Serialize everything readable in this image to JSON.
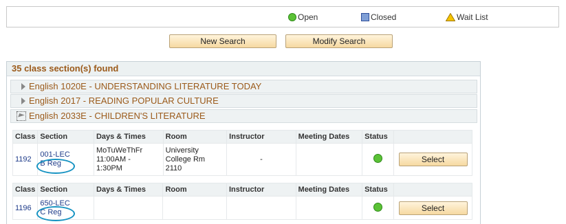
{
  "legend": {
    "open_label": "Open",
    "closed_label": "Closed",
    "wait_label": "Wait List"
  },
  "buttons": {
    "new_search": "New Search",
    "modify_search": "Modify Search"
  },
  "results": {
    "header": "35 class section(s) found",
    "courses": [
      {
        "title": "English 1020E - UNDERSTANDING LITERATURE TODAY",
        "expanded": false
      },
      {
        "title": "English 2017 - READING POPULAR CULTURE",
        "expanded": false
      },
      {
        "title": "English 2033E - CHILDREN'S LITERATURE",
        "expanded": true
      }
    ],
    "columns": [
      "Class",
      "Section",
      "Days & Times",
      "Room",
      "Instructor",
      "Meeting Dates",
      "Status",
      ""
    ],
    "sections": [
      {
        "class": "1192",
        "section_line1": "001-LEC",
        "section_line2": "B Reg",
        "days_times_1": "MoTuWeThFr",
        "days_times_2": "11:00AM -",
        "days_times_3": "1:30PM",
        "room_1": "University",
        "room_2": "College Rm",
        "room_3": "2110",
        "instructor": "-",
        "meeting_dates": "",
        "status": "Open",
        "select_label": "Select"
      },
      {
        "class": "1196",
        "section_line1": "650-LEC",
        "section_line2": "C Reg",
        "status": "Open",
        "select_label": "Select"
      }
    ]
  },
  "colors": {
    "open": "#5bc236",
    "closed": "#7f9fd6",
    "wait": "#f5c400",
    "course_title": "#9b5a1a",
    "highlight_ring": "#1693c2"
  }
}
